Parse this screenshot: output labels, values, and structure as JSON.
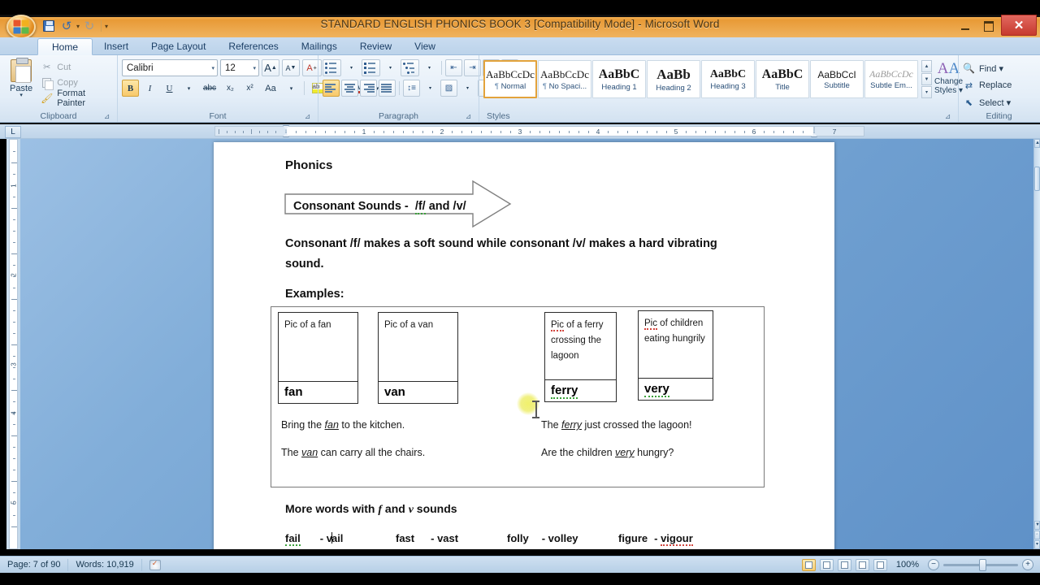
{
  "window": {
    "title": "STANDARD ENGLISH PHONICS BOOK 3 [Compatibility Mode]  -  Microsoft Word",
    "minimize_label": "",
    "restore_label": "",
    "close_label": "✕"
  },
  "quick_access": {
    "save": "save-icon",
    "undo": "↺",
    "undo_caret": "▾",
    "redo": "↻",
    "customize_caret": "▾"
  },
  "ribbon": {
    "tabs": [
      {
        "label": "Home",
        "active": true
      },
      {
        "label": "Insert",
        "active": false
      },
      {
        "label": "Page Layout",
        "active": false
      },
      {
        "label": "References",
        "active": false
      },
      {
        "label": "Mailings",
        "active": false
      },
      {
        "label": "Review",
        "active": false
      },
      {
        "label": "View",
        "active": false
      }
    ],
    "groups": {
      "clipboard": {
        "label": "Clipboard",
        "paste": "Paste",
        "paste_caret": "▾",
        "items": [
          {
            "label": "Cut",
            "icon": "scissors-icon",
            "enabled": false
          },
          {
            "label": "Copy",
            "icon": "copy-icon",
            "enabled": false
          },
          {
            "label": "Format Painter",
            "icon": "format-painter-icon",
            "enabled": true
          }
        ]
      },
      "font": {
        "label": "Font",
        "font_name": "Calibri",
        "font_size": "12",
        "grow_font": "A",
        "shrink_font": "A",
        "clear_formatting": "clear-formatting-icon",
        "bold": "B",
        "italic": "I",
        "underline": "U",
        "underline_caret": "▾",
        "strikethrough": "abc",
        "subscript": "x₂",
        "superscript": "x²",
        "change_case": "Aa",
        "change_case_caret": "▾",
        "text_highlight": "highlight-icon",
        "highlight_caret": "▾",
        "font_color": "A",
        "font_color_caret": "▾",
        "bold_active": true
      },
      "paragraph": {
        "label": "Paragraph",
        "bullets": "bullets-icon",
        "numbering": "numbering-icon",
        "multilevel": "multilevel-list-icon",
        "decrease_indent": "decrease-indent-icon",
        "increase_indent": "increase-indent-icon",
        "sort": "sort-icon",
        "show_marks": "¶",
        "align_left": "align-left-icon",
        "align_center": "align-center-icon",
        "align_right": "align-right-icon",
        "justify": "justify-icon",
        "line_spacing": "line-spacing-icon",
        "shading": "shading-icon",
        "borders": "borders-icon",
        "align_left_active": true
      },
      "styles": {
        "label": "Styles",
        "items": [
          {
            "sample": "AaBbCcDc",
            "name": "Normal",
            "pilcrow": true,
            "selected": true,
            "serif": false
          },
          {
            "sample": "AaBbCcDc",
            "name": "No Spaci...",
            "pilcrow": true,
            "selected": false,
            "serif": false
          },
          {
            "sample": "AaBbC",
            "name": "Heading 1",
            "pilcrow": false,
            "selected": false,
            "serif": true
          },
          {
            "sample": "AaBb",
            "name": "Heading 2",
            "pilcrow": false,
            "selected": false,
            "serif": true
          },
          {
            "sample": "AaBbC",
            "name": "Heading 3",
            "pilcrow": false,
            "selected": false,
            "serif": true
          },
          {
            "sample": "AaBbC",
            "name": "Title",
            "pilcrow": false,
            "selected": false,
            "serif": true
          },
          {
            "sample": "AaBbCcI",
            "name": "Subtitle",
            "pilcrow": false,
            "selected": false,
            "serif": false
          },
          {
            "sample": "AaBbCcDc",
            "name": "Subtle Em...",
            "pilcrow": false,
            "selected": false,
            "serif": false
          }
        ],
        "scroll_up": "▲",
        "scroll_down": "▼",
        "more": "▾",
        "change_styles_line1": "Change",
        "change_styles_line2": "Styles ▾"
      },
      "editing": {
        "label": "Editing",
        "items": [
          {
            "label": "Find ▾",
            "icon": "find-icon"
          },
          {
            "label": "Replace",
            "icon": "replace-icon"
          },
          {
            "label": "Select ▾",
            "icon": "select-icon"
          }
        ]
      }
    },
    "dialog_launcher": "⊿"
  },
  "ruler": {
    "tab_selector": "L",
    "horizontal_numbers": [
      "1",
      "1",
      "2",
      "3",
      "4",
      "5",
      "6",
      "7"
    ],
    "vertical_numbers": [
      "1",
      "2",
      "3",
      "4",
      "5"
    ],
    "unit": "inches"
  },
  "document": {
    "heading_small": "Phonics",
    "banner_text": "Consonant Sounds -  /f/ and /v/",
    "body_paragraph": "Consonant /f/ makes a soft sound while consonant /v/ makes a hard vibrating sound.",
    "examples_label": "Examples:",
    "table_cells": [
      {
        "caption": "Pic of a fan",
        "word": "fan",
        "spell_error": false,
        "word_error": false,
        "tall": false
      },
      {
        "caption": "Pic of a van",
        "word": "van",
        "spell_error": false,
        "word_error": false,
        "tall": false
      },
      {
        "caption": "Pic of a ferry crossing the lagoon",
        "word": "ferry",
        "spell_error": true,
        "word_error": true,
        "tall": true
      },
      {
        "caption": "Pic of children eating hungrily",
        "word": "very",
        "spell_error": true,
        "word_error": true,
        "tall": true
      }
    ],
    "sentences": [
      {
        "left_pre": "Bring the ",
        "left_word": "fan",
        "left_post": " to the kitchen.",
        "right_pre": "The ",
        "right_word": "ferry",
        "right_post": " just crossed the lagoon!"
      },
      {
        "left_pre": "The ",
        "left_word": "van",
        "left_post": " can carry all the chairs.",
        "right_pre": "Are the children ",
        "right_word": "very",
        "right_post": " hungry?"
      }
    ],
    "more_words_heading_pre": "More words with ",
    "more_words_heading_f": "f",
    "more_words_heading_mid": " and ",
    "more_words_heading_v": "v",
    "more_words_heading_post": " sounds",
    "word_pairs": [
      {
        "left": "fail",
        "right": "- vail",
        "left_error": true,
        "right_error": false,
        "caret": true
      },
      {
        "left": "fast",
        "right": "- vast",
        "left_error": false,
        "right_error": false,
        "caret": false
      },
      {
        "left": "folly",
        "right": "- volley",
        "left_error": false,
        "right_error": false,
        "caret": false
      },
      {
        "left": "figure",
        "right": "- vigour",
        "left_error": false,
        "right_error": true,
        "caret": false
      }
    ]
  },
  "status_bar": {
    "page": "Page: 7 of 90",
    "words": "Words: 10,919",
    "proofing_icon": "proofing-errors-icon",
    "zoom_level": "100%",
    "zoom_out": "−",
    "zoom_in": "+",
    "view_buttons": [
      {
        "name": "print-layout-view",
        "active": true
      },
      {
        "name": "full-screen-reading-view",
        "active": false
      },
      {
        "name": "web-layout-view",
        "active": false
      },
      {
        "name": "outline-view",
        "active": false
      },
      {
        "name": "draft-view",
        "active": false
      }
    ]
  },
  "colors": {
    "title_bar": "#efa94b",
    "ribbon": "#e4eef8",
    "accent_selected": "#e3a33c",
    "close_button": "#c63a2e",
    "doc_background": "#6f9fd0",
    "spell_error": "#d2453d",
    "grammar_error": "#3aa13a"
  }
}
